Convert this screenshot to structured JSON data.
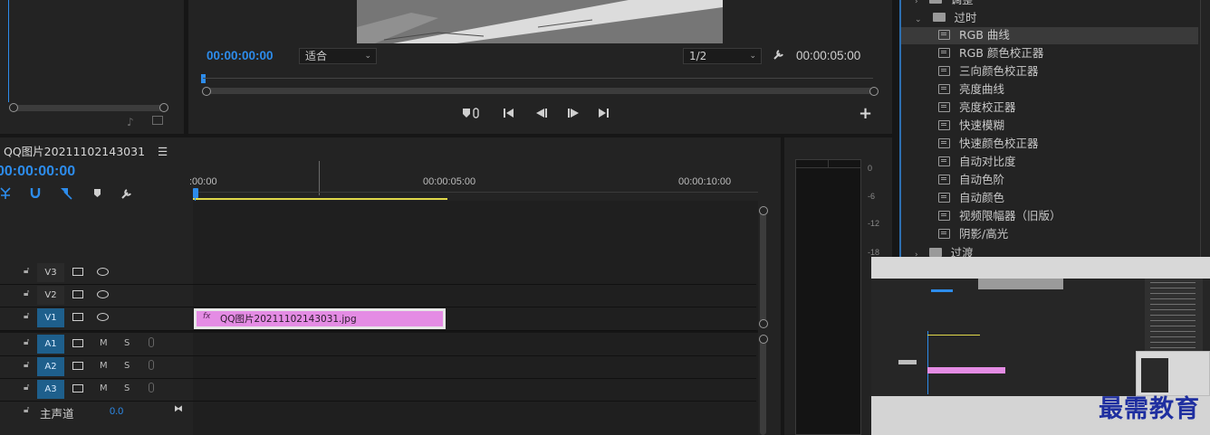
{
  "program_monitor": {
    "timecode_current": "00:00:00:00",
    "fit_value": "适合",
    "resolution_value": "1/2",
    "timecode_duration": "00:00:05:00"
  },
  "timeline": {
    "sequence_name": "QQ图片20211102143031",
    "menu_icon": "☰",
    "timecode": "00:00:00:00",
    "ruler": [
      ":00:00",
      "00:00:05:00",
      "00:00:10:00"
    ],
    "tracks": {
      "v3": "V3",
      "v2": "V2",
      "v1": "V1",
      "a1": "A1",
      "a2": "A2",
      "a3": "A3",
      "master_label": "主声道",
      "master_value": "0.0"
    },
    "m_label": "M",
    "s_label": "S",
    "clip": {
      "fx": "fx",
      "name": "QQ图片20211102143031.jpg"
    }
  },
  "effects": {
    "folder_partial": "调整",
    "folder_open": "过时",
    "items": [
      "RGB 曲线",
      "RGB 颜色校正器",
      "三向颜色校正器",
      "亮度曲线",
      "亮度校正器",
      "快速模糊",
      "快速颜色校正器",
      "自动对比度",
      "自动色阶",
      "自动颜色",
      "视频限幅器（旧版）",
      "阴影/高光"
    ],
    "folder_next": "过渡"
  },
  "audio_meter": {
    "ticks": [
      "0",
      "-6",
      "-12",
      "-18"
    ]
  },
  "watermark": {
    "text": "最需教育"
  },
  "colors": {
    "accent": "#2d8ceb",
    "clip": "#e48ce4",
    "work_area": "#e0d84a",
    "selected_track": "#1e5f8c"
  }
}
